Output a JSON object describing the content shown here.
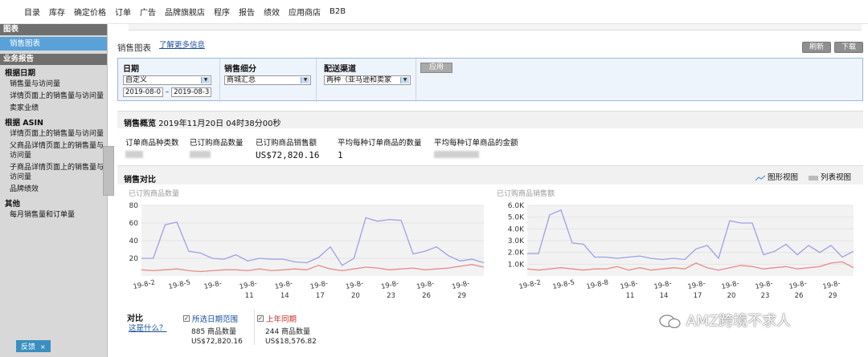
{
  "topnav": {
    "items": [
      "目录",
      "库存",
      "确定价格",
      "订单",
      "广告",
      "品牌旗舰店",
      "程序",
      "报告",
      "绩效",
      "应用商店",
      "B2B"
    ]
  },
  "sidebar": {
    "header1": "图表",
    "active_item": "销售图表",
    "header2": "业务报告",
    "groups": [
      {
        "title": "根据日期",
        "items": [
          "销售量与访问量",
          "详情页面上的销售量与访问量",
          "卖家业绩"
        ]
      },
      {
        "title": "根据 ASIN",
        "items": [
          "详情页面上的销售量与访问量",
          "父商品详情页面上的销售量与访问量",
          "子商品详情页面上的销售量与访问量",
          "品牌绩效"
        ]
      },
      {
        "title": "其他",
        "items": [
          "每月销售量和订单量"
        ]
      }
    ],
    "feedback": "反馈",
    "feedback_close": "×"
  },
  "main": {
    "title": "销售图表",
    "learn_more": "了解更多信息",
    "refresh_button": "刷新",
    "download_button": "下载"
  },
  "filters": {
    "date_label": "日期",
    "date_value": "自定义",
    "date_from": "2019-08-0",
    "date_to": "2019-08-3",
    "date_sep": "–",
    "segment_label": "销售细分",
    "segment_value": "商城汇总",
    "channel_label": "配送渠道",
    "channel_value": "两种（亚马逊和卖家",
    "apply_button": "应用",
    "arrow": "▼"
  },
  "summary": {
    "title": "销售概览",
    "timestamp": "2019年11月20日 04时38分00秒",
    "metrics": [
      {
        "label": "订单商品种类数",
        "value": ""
      },
      {
        "label": "已订购商品数量",
        "value": ""
      },
      {
        "label": "已订购商品销售额",
        "value": "US$72,820.16"
      },
      {
        "label": "平均每种订单商品的数量",
        "value": "1"
      },
      {
        "label": "平均每种订单商品的金额",
        "value": ""
      }
    ]
  },
  "compare": {
    "title": "销售对比",
    "graph_view": "图形视图",
    "list_view": "列表视图"
  },
  "legend": {
    "compare_label": "对比",
    "whats_this": "这是什么？",
    "selected": {
      "name": "所选日期范围",
      "qty": "885 商品数量",
      "sales": "US$72,820.16"
    },
    "last_year": {
      "name": "上年同期",
      "qty": "244 商品数量",
      "sales": "US$18,576.82"
    },
    "check": "✓"
  },
  "watermark": "AMZ跨境不求人",
  "colors": {
    "selected_series": "#9e9ee8",
    "last_year_series": "#e88a8a",
    "link": "#1a4fa0",
    "sidebar_active": "#5aa1d8"
  },
  "chart_data": [
    {
      "type": "line",
      "title": "已订购商品数量",
      "ylim": [
        0,
        80
      ],
      "yticks": [
        "20",
        "40",
        "60",
        "80"
      ],
      "yticks_values": [
        20,
        40,
        60,
        80
      ],
      "x": [
        "19-8-2",
        "19-8-3",
        "19-8-4",
        "19-8-5",
        "19-8-6",
        "19-8-7",
        "19-8-8",
        "19-8-9",
        "19-8-10",
        "19-8-11",
        "19-8-12",
        "19-8-13",
        "19-8-14",
        "19-8-15",
        "19-8-16",
        "19-8-17",
        "19-8-18",
        "19-8-19",
        "19-8-20",
        "19-8-21",
        "19-8-22",
        "19-8-23",
        "19-8-24",
        "19-8-25",
        "19-8-26",
        "19-8-27",
        "19-8-28",
        "19-8-29",
        "19-8-30",
        "19-8-31"
      ],
      "xtick_labels": [
        {
          "i": 0,
          "l1": "19-8-2",
          "l2": ""
        },
        {
          "i": 3,
          "l1": "19-8-5",
          "l2": ""
        },
        {
          "i": 6,
          "l1": "19-8-",
          "l2": ""
        },
        {
          "i": 9,
          "l1": "19-8-",
          "l2": "11"
        },
        {
          "i": 12,
          "l1": "19-8-",
          "l2": "14"
        },
        {
          "i": 15,
          "l1": "19-8-",
          "l2": "17"
        },
        {
          "i": 18,
          "l1": "19-8-",
          "l2": "20"
        },
        {
          "i": 21,
          "l1": "19-8-",
          "l2": "23"
        },
        {
          "i": 24,
          "l1": "19-8-",
          "l2": "26"
        },
        {
          "i": 27,
          "l1": "19-8-",
          "l2": "29"
        }
      ],
      "series": [
        {
          "name": "所选日期范围",
          "values": [
            20,
            20,
            58,
            61,
            28,
            26,
            20,
            19,
            24,
            17,
            20,
            19,
            19,
            16,
            15,
            21,
            33,
            12,
            20,
            66,
            62,
            64,
            63,
            25,
            28,
            33,
            23,
            17,
            19,
            15
          ]
        },
        {
          "name": "上年同期",
          "values": [
            7,
            6,
            7,
            8,
            6,
            5,
            6,
            7,
            7,
            6,
            8,
            6,
            7,
            8,
            7,
            12,
            8,
            6,
            8,
            10,
            9,
            7,
            8,
            9,
            7,
            8,
            9,
            11,
            13,
            10
          ]
        }
      ]
    },
    {
      "type": "line",
      "title": "已订购商品销售额",
      "ylim": [
        0,
        6000
      ],
      "yticks": [
        "1.0K",
        "2.0K",
        "3.0K",
        "4.0K",
        "5.0K",
        "6.0K"
      ],
      "yticks_values": [
        1000,
        2000,
        3000,
        4000,
        5000,
        6000
      ],
      "x": [
        "19-8-2",
        "19-8-3",
        "19-8-4",
        "19-8-5",
        "19-8-6",
        "19-8-7",
        "19-8-8",
        "19-8-9",
        "19-8-10",
        "19-8-11",
        "19-8-12",
        "19-8-13",
        "19-8-14",
        "19-8-15",
        "19-8-16",
        "19-8-17",
        "19-8-18",
        "19-8-19",
        "19-8-20",
        "19-8-21",
        "19-8-22",
        "19-8-23",
        "19-8-24",
        "19-8-25",
        "19-8-26",
        "19-8-27",
        "19-8-28",
        "19-8-29",
        "19-8-30",
        "19-8-31"
      ],
      "xtick_labels": [
        {
          "i": 0,
          "l1": "19-8-2",
          "l2": ""
        },
        {
          "i": 3,
          "l1": "19-8-5",
          "l2": ""
        },
        {
          "i": 6,
          "l1": "19-8-8",
          "l2": ""
        },
        {
          "i": 9,
          "l1": "19-8-",
          "l2": "11"
        },
        {
          "i": 12,
          "l1": "19-8-",
          "l2": "14"
        },
        {
          "i": 15,
          "l1": "19-8-",
          "l2": "17"
        },
        {
          "i": 18,
          "l1": "19-8-",
          "l2": "20"
        },
        {
          "i": 21,
          "l1": "19-8-",
          "l2": "23"
        },
        {
          "i": 24,
          "l1": "19-8-",
          "l2": "26"
        },
        {
          "i": 27,
          "l1": "19-8-",
          "l2": "29"
        }
      ],
      "series": [
        {
          "name": "所选日期范围",
          "values": [
            1900,
            1900,
            5200,
            5600,
            2800,
            2700,
            1600,
            1600,
            1500,
            1600,
            1700,
            1500,
            1400,
            1500,
            1400,
            2300,
            2600,
            1500,
            4700,
            4500,
            4500,
            1800,
            2100,
            2700,
            1800,
            2600,
            2000,
            2600,
            1600,
            2100
          ]
        },
        {
          "name": "上年同期",
          "values": [
            600,
            500,
            600,
            700,
            600,
            500,
            600,
            600,
            800,
            500,
            700,
            500,
            600,
            700,
            600,
            1100,
            700,
            500,
            700,
            900,
            800,
            600,
            700,
            800,
            600,
            700,
            800,
            1100,
            1200,
            700
          ]
        }
      ]
    }
  ]
}
